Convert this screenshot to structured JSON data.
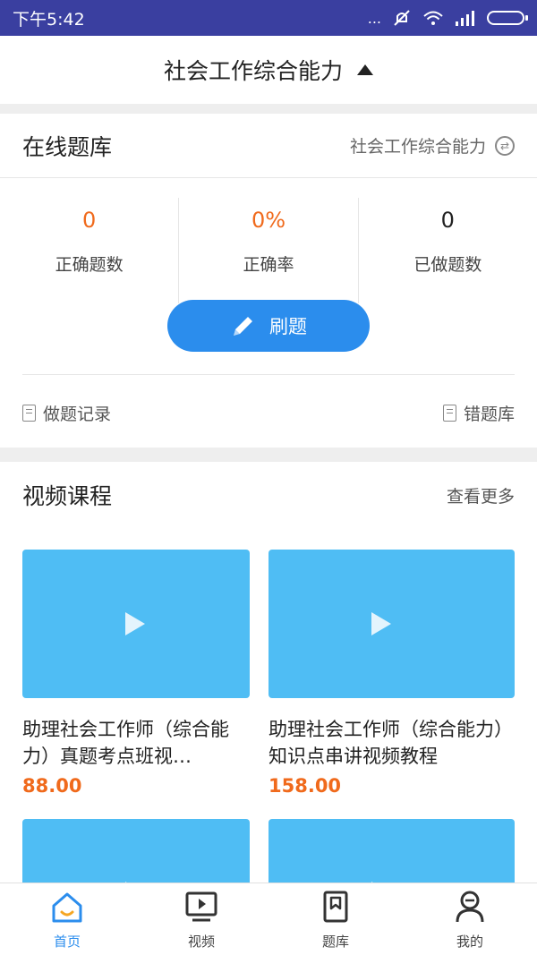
{
  "status_bar": {
    "time": "下午5:42",
    "dots": "..."
  },
  "header": {
    "title": "社会工作综合能力"
  },
  "question_bank": {
    "title": "在线题库",
    "subject": "社会工作综合能力",
    "stats": [
      {
        "value": "0",
        "label": "正确题数",
        "color": "#f06a1c"
      },
      {
        "value": "0%",
        "label": "正确率",
        "color": "#f06a1c"
      },
      {
        "value": "0",
        "label": "已做题数",
        "color": "#222222"
      }
    ],
    "practice_button": "刷题",
    "history_link": "做题记录",
    "wrong_link": "错题库"
  },
  "video_courses": {
    "title": "视频课程",
    "more": "查看更多",
    "items": [
      {
        "title": "助理社会工作师（综合能力）真题考点班视…",
        "price": "88.00"
      },
      {
        "title": "助理社会工作师（综合能力）知识点串讲视频教程",
        "price": "158.00"
      }
    ]
  },
  "tabs": [
    {
      "label": "首页",
      "icon": "home-icon",
      "active": true
    },
    {
      "label": "视频",
      "icon": "video-icon",
      "active": false
    },
    {
      "label": "题库",
      "icon": "bookmark-icon",
      "active": false
    },
    {
      "label": "我的",
      "icon": "person-icon",
      "active": false
    }
  ],
  "colors": {
    "accent": "#2b8ded",
    "orange": "#f06a1c",
    "thumb": "#4fbdf4",
    "statusbar": "#3a3fa0"
  }
}
